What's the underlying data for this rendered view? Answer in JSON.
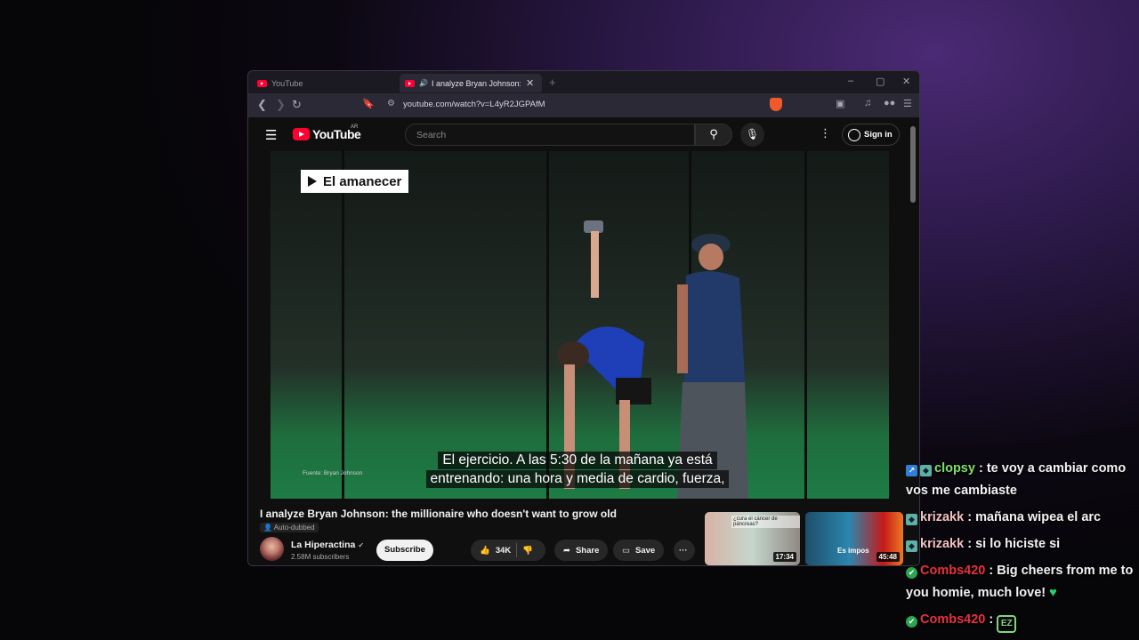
{
  "browser": {
    "tabs": [
      {
        "title": "YouTube",
        "active": false
      },
      {
        "title": "I analyze Bryan Johnson: the m",
        "active": true
      }
    ],
    "new_tab": "+",
    "url": "youtube.com/watch?v=L4yR2JGPAfM",
    "window_controls": {
      "minimize": "–",
      "maximize": "▢",
      "close": "✕"
    },
    "icons": [
      "back-icon",
      "forward-icon",
      "reload-icon",
      "bookmark-icon",
      "site-info-icon",
      "brave-shield-icon",
      "screenshot-icon",
      "music-icon",
      "extension-icon",
      "menu-icon"
    ]
  },
  "youtube": {
    "logo_text": "YouTube",
    "logo_country": "AR",
    "search_placeholder": "Search",
    "sign_in": "Sign in"
  },
  "video": {
    "overlay_tag": "El amanecer",
    "source_text": "Fuente: Bryan Johnson",
    "captions": [
      "El ejercicio. A las 5:30 de la mañana ya está",
      "entrenando: una hora y media de cardio, fuerza,"
    ],
    "title": "I analyze Bryan Johnson: the millionaire who doesn't want to grow old",
    "auto_dubbed": "Auto-dubbed",
    "channel": "La Hiperactina",
    "subscribers": "2.58M subscribers",
    "subscribe_label": "Subscribe",
    "likes": "34K",
    "share_label": "Share",
    "save_label": "Save"
  },
  "related": [
    {
      "duration": "17:34",
      "caption": "¿cura el cáncer de páncreas?"
    },
    {
      "duration": "45:48",
      "caption": "Es impos"
    }
  ],
  "chat": [
    {
      "user": "clopsy",
      "text": "te voy a cambiar como vos me cambiaste"
    },
    {
      "user": "krizakk",
      "text": "mañana wipea el arc"
    },
    {
      "user": "krizakk",
      "text": "si lo hiciste si"
    },
    {
      "user": "Combs420",
      "text": "Big cheers from me to you homie, much love!",
      "emoji": "♥"
    },
    {
      "user": "Combs420",
      "text": "",
      "emote": "EZ"
    }
  ]
}
